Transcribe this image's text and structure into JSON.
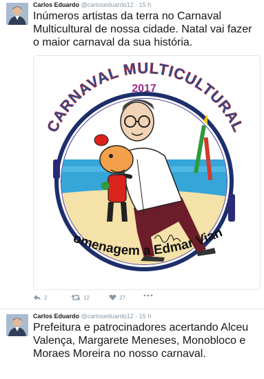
{
  "tweets": [
    {
      "author_name": "Carlos Eduardo",
      "handle": "@carloseduardo12",
      "separator": "·",
      "time": "15 h",
      "text": "Inúmeros artistas da terra no Carnaval Multicultural de nossa cidade. Natal vai fazer o maior carnaval da sua história.",
      "media": {
        "arc_title": "CARNAVAL MULTICULTURAL",
        "year": "2017",
        "tribute": "homenagem a Edmar Viana",
        "signature": "Edmar"
      },
      "actions": {
        "replies": "2",
        "retweets": "12",
        "likes": "27"
      },
      "icons": [
        "reply-icon",
        "retweet-icon",
        "heart-icon",
        "more-icon"
      ]
    },
    {
      "author_name": "Carlos Eduardo",
      "handle": "@carloseduardo12",
      "separator": "·",
      "time": "15 h",
      "text": "Prefeitura e patrocinadores acertando Alceu Valença, Margarete Meneses, Monobloco e Moraes Moreira no nosso carnaval."
    }
  ],
  "colors": {
    "text": "#14171a",
    "muted": "#8899a6",
    "border": "#e1e8ed",
    "ring_navy": "#1d2e6b",
    "ring_purple": "#4a3aa0",
    "sky": "#36a5d8",
    "sand": "#f5e2a8"
  }
}
